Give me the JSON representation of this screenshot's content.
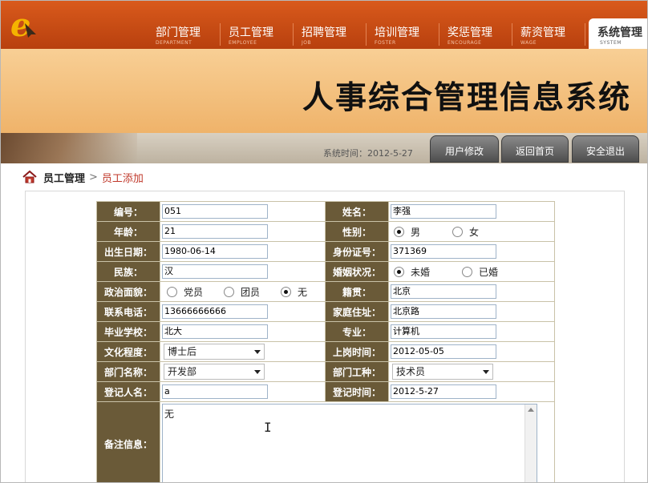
{
  "header": {
    "nav": [
      {
        "label": "部门管理",
        "en": "DEPARTMENT"
      },
      {
        "label": "员工管理",
        "en": "EMPLOYEE"
      },
      {
        "label": "招聘管理",
        "en": "JOB"
      },
      {
        "label": "培训管理",
        "en": "FOSTER"
      },
      {
        "label": "奖惩管理",
        "en": "ENCOURAGE"
      },
      {
        "label": "薪资管理",
        "en": "WAGE"
      },
      {
        "label": "系统管理",
        "en": "SYSTEM"
      }
    ],
    "active_nav": "系统管理"
  },
  "banner": {
    "title": "人事综合管理信息系统"
  },
  "statusbar": {
    "time": "系统时间：2012-5-27",
    "btn_user": "用户修改",
    "btn_home": "返回首页",
    "btn_exit": "安全退出"
  },
  "breadcrumb": {
    "parent": "员工管理",
    "sep": ">",
    "current": "员工添加"
  },
  "form": {
    "id": {
      "label": "编号：",
      "value": "051"
    },
    "name": {
      "label": "姓名：",
      "value": "李强"
    },
    "age": {
      "label": "年龄：",
      "value": "21"
    },
    "gender": {
      "label": "性别：",
      "options": [
        "男",
        "女"
      ],
      "selected": "男"
    },
    "birth": {
      "label": "出生日期：",
      "value": "1980-06-14"
    },
    "idcard": {
      "label": "身份证号：",
      "value": "371369"
    },
    "ethnic": {
      "label": "民族：",
      "value": "汉"
    },
    "marital": {
      "label": "婚姻状况：",
      "options": [
        "未婚",
        "已婚"
      ],
      "selected": "未婚"
    },
    "political": {
      "label": "政治面貌：",
      "options": [
        "党员",
        "团员",
        "无"
      ],
      "selected": "无"
    },
    "native": {
      "label": "籍贯：",
      "value": "北京"
    },
    "phone": {
      "label": "联系电话：",
      "value": "13666666666"
    },
    "address": {
      "label": "家庭住址：",
      "value": "北京路"
    },
    "school": {
      "label": "毕业学校：",
      "value": "北大"
    },
    "major": {
      "label": "专业：",
      "value": "计算机"
    },
    "education": {
      "label": "文化程度：",
      "value": "博士后"
    },
    "hiredate": {
      "label": "上岗时间：",
      "value": "2012-05-05"
    },
    "dept": {
      "label": "部门名称：",
      "value": "开发部"
    },
    "jobtype": {
      "label": "部门工种：",
      "value": "技术员"
    },
    "registrar": {
      "label": "登记人名：",
      "value": "a"
    },
    "regtime": {
      "label": "登记时间：",
      "value": "2012-5-27"
    },
    "remark": {
      "label": "备注信息：",
      "value": "无"
    }
  },
  "colors": {
    "accent": "#c9501a",
    "label_bg": "#6a5a38",
    "banner": "#f4c283"
  }
}
